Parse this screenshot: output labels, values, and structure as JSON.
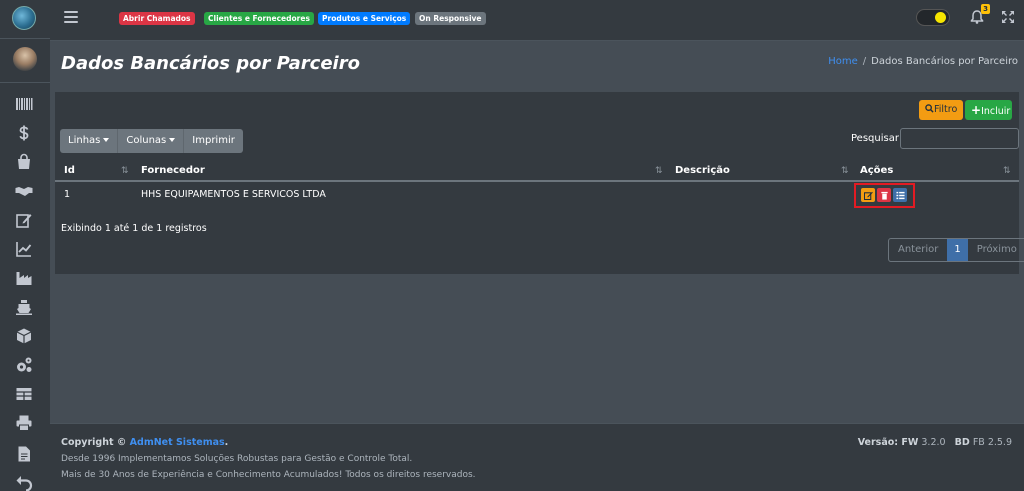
{
  "navbar": {
    "badges": [
      {
        "label": "Abrir Chamados",
        "color": "#dc3545"
      },
      {
        "label": "Clientes e Fornecedores",
        "color": "#28a745"
      },
      {
        "label": "Produtos e Serviços",
        "color": "#007bff"
      },
      {
        "label": "On Responsive",
        "color": "#6c757d"
      }
    ],
    "notification_count": "3"
  },
  "sidebar": {
    "icons": [
      "barcode-icon",
      "dollar-icon",
      "shopping-bag-icon",
      "handshake-icon",
      "edit-icon",
      "chart-line-icon",
      "industry-icon",
      "ship-icon",
      "box-icon",
      "cogs-icon",
      "table-icon",
      "print-icon",
      "file-icon",
      "undo-icon"
    ]
  },
  "header": {
    "title": "Dados Bancários por Parceiro",
    "breadcrumb_home": "Home",
    "breadcrumb_current": "Dados Bancários por Parceiro"
  },
  "toolbar": {
    "filter_label": "Filtro",
    "add_label": "Incluir",
    "lines_label": "Linhas",
    "columns_label": "Colunas",
    "print_label": "Imprimir",
    "search_label": "Pesquisar",
    "search_value": ""
  },
  "table": {
    "columns": [
      "Id",
      "Fornecedor",
      "Descrição",
      "Ações"
    ],
    "rows": [
      {
        "id": "1",
        "fornecedor": "HHS EQUIPAMENTOS E SERVICOS LTDA",
        "descricao": ""
      }
    ],
    "info": "Exibindo 1 até 1 de 1 registros",
    "pager": {
      "prev": "Anterior",
      "current": "1",
      "next": "Próximo"
    }
  },
  "footer": {
    "copyright_prefix": "Copyright ©",
    "brand": "AdmNet Sistemas",
    "copyright_suffix": ".",
    "line1": "Desde 1996 Implementamos Soluções Robustas para Gestão e Controle Total.",
    "line2": "Mais de 30 Anos de Experiência e Conhecimento Acumulados! Todos os direitos reservados.",
    "version_label": "Versão: FW",
    "version_fw": "3.2.0",
    "version_bd_label": "BD",
    "version_bd": "FB 2.5.9"
  },
  "colors": {
    "accent_blue": "#3f8ff0",
    "action_edit": "#f39c12",
    "action_delete": "#dc3545",
    "action_list": "#3f6fa8",
    "highlight_frame": "#e31b23"
  }
}
